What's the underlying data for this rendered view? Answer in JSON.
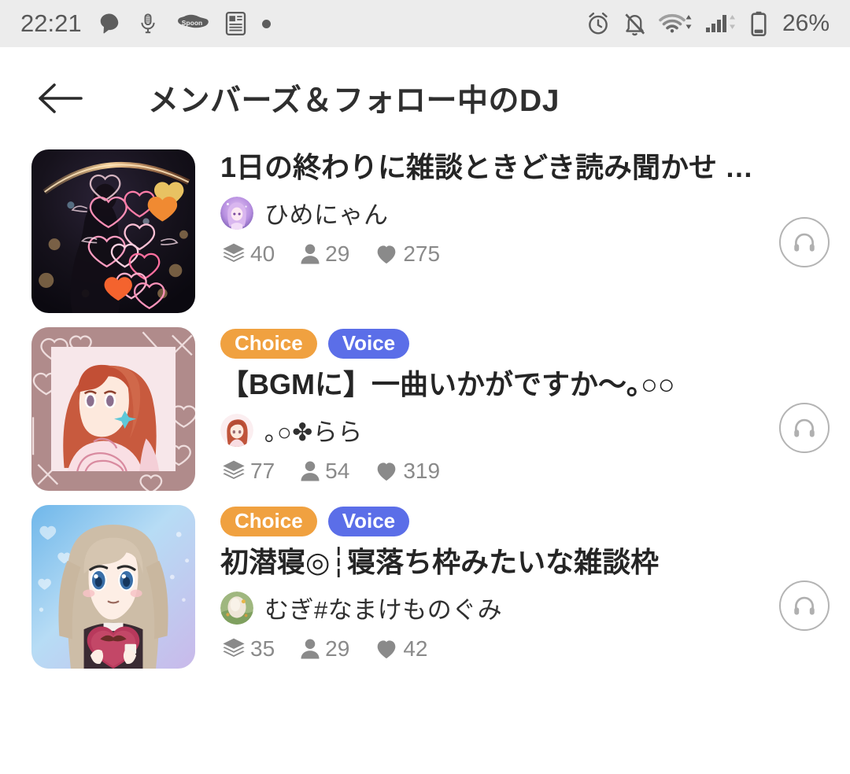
{
  "statusbar": {
    "time": "22:21",
    "battery_text": "26%",
    "left_icons": [
      "chat-bubble-icon",
      "microphone-icon",
      "spoon-app-icon",
      "news-widget-icon",
      "dot-indicator-icon"
    ],
    "right_icons": [
      "alarm-clock-icon",
      "notifications-off-icon",
      "wifi-icon",
      "mobile-signal-icon",
      "battery-icon"
    ],
    "background": "#ececec",
    "icon_color": "#5d5d5d"
  },
  "header": {
    "back_label": "back-arrow",
    "title": "メンバーズ＆フォロー中のDJ"
  },
  "colors": {
    "badge_choice": "#f0a140",
    "badge_voice": "#5b6ee8",
    "title_text": "#252525",
    "stat_text": "#8a8a8a",
    "page_background": "#ffffff"
  },
  "list": [
    {
      "thumbnail": "neon-hearts-cosmic-thumbnail",
      "badges": [],
      "title": "1日の終わりに雑談ときどき読み聞かせ …",
      "dj_avatar": "purple-anime-avatar",
      "dj_name": "ひめにゃん",
      "stats": [
        {
          "icon": "layers-icon",
          "value": "40"
        },
        {
          "icon": "person-icon",
          "value": "29"
        },
        {
          "icon": "heart-icon",
          "value": "275"
        }
      ],
      "action": "listen-headphone-button"
    },
    {
      "thumbnail": "red-haired-anime-girl-thumbnail",
      "badges": [
        "Choice",
        "Voice"
      ],
      "title": "【BGMに】一曲いかがですか〜｡○○",
      "dj_avatar": "red-haired-anime-avatar",
      "dj_name": "｡○✤らら",
      "stats": [
        {
          "icon": "layers-icon",
          "value": "77"
        },
        {
          "icon": "person-icon",
          "value": "54"
        },
        {
          "icon": "heart-icon",
          "value": "319"
        }
      ],
      "action": "listen-headphone-button"
    },
    {
      "thumbnail": "blonde-anime-girl-heart-thumbnail",
      "badges": [
        "Choice",
        "Voice"
      ],
      "title": "初潜寝◎┆寝落ち枠みたいな雑談枠",
      "dj_avatar": "blonde-anime-avatar",
      "dj_name": "むぎ#なまけものぐみ",
      "stats": [
        {
          "icon": "layers-icon",
          "value": "35"
        },
        {
          "icon": "person-icon",
          "value": "29"
        },
        {
          "icon": "heart-icon",
          "value": "42"
        }
      ],
      "action": "listen-headphone-button"
    }
  ]
}
